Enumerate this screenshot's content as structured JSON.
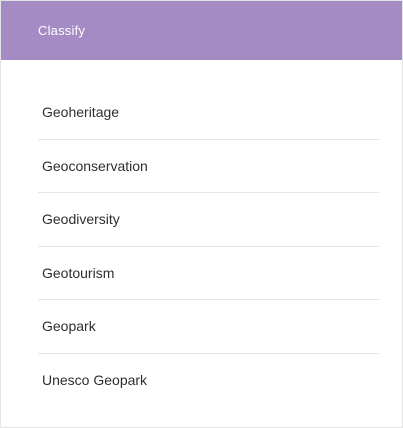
{
  "header": {
    "title": "Classify",
    "color": "#a58bc3"
  },
  "categories": [
    {
      "label": "Geoheritage"
    },
    {
      "label": "Geoconservation"
    },
    {
      "label": "Geodiversity"
    },
    {
      "label": "Geotourism"
    },
    {
      "label": "Geopark"
    },
    {
      "label": "Unesco Geopark"
    }
  ]
}
